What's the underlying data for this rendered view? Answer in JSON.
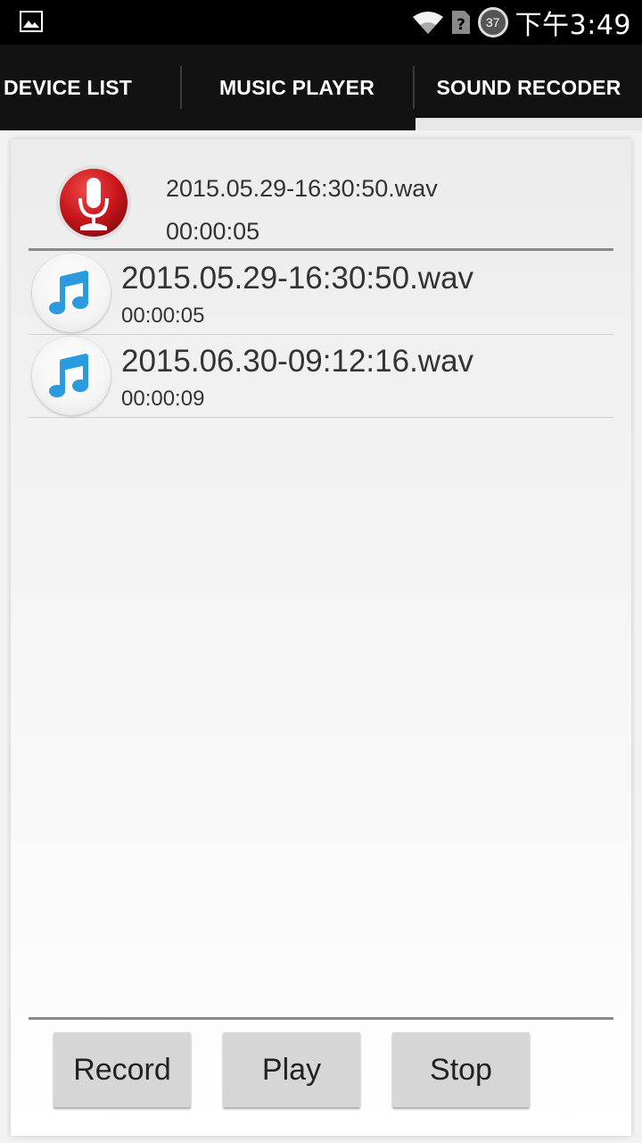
{
  "status_bar": {
    "time": "下午3:49",
    "battery_level": "37",
    "icons": [
      "image-icon",
      "wifi-icon",
      "no-sim-icon",
      "battery-icon"
    ]
  },
  "tabs": [
    {
      "label": "DEVICE LIST"
    },
    {
      "label": "MUSIC PLAYER"
    },
    {
      "label": "SOUND RECODER",
      "selected": true
    }
  ],
  "current": {
    "filename": "2015.05.29-16:30:50.wav",
    "duration": "00:00:05"
  },
  "recordings": [
    {
      "filename": "2015.05.29-16:30:50.wav",
      "duration": "00:00:05"
    },
    {
      "filename": "2015.06.30-09:12:16.wav",
      "duration": "00:00:09"
    }
  ],
  "controls": {
    "record_label": "Record",
    "play_label": "Play",
    "stop_label": "Stop"
  },
  "colors": {
    "tab_bar": "#121212",
    "mic_red": "#c8161c",
    "note_blue": "#2b9be0",
    "button_bg": "#d6d6d6"
  }
}
